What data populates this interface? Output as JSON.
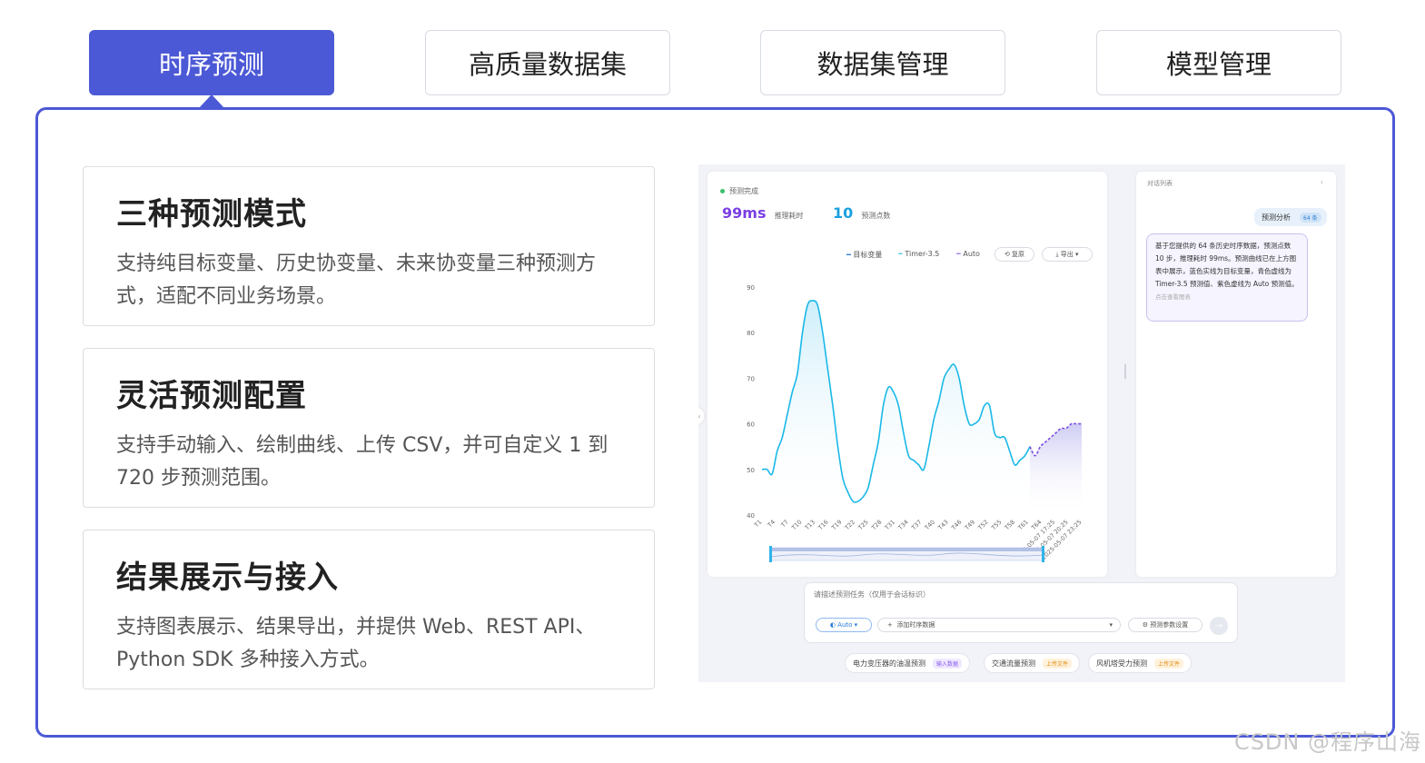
{
  "tabs": [
    {
      "label": "时序预测",
      "active": true
    },
    {
      "label": "高质量数据集",
      "active": false
    },
    {
      "label": "数据集管理",
      "active": false
    },
    {
      "label": "模型管理",
      "active": false
    }
  ],
  "features": [
    {
      "title": "三种预测模式",
      "desc": "支持纯目标变量、历史协变量、未来协变量三种预测方式，适配不同业务场景。"
    },
    {
      "title": "灵活预测配置",
      "desc": "支持手动输入、绘制曲线、上传 CSV，并可自定义 1 到 720 步预测范围。"
    },
    {
      "title": "结果展示与接入",
      "desc": "支持图表展示、结果导出，并提供 Web、REST API、Python SDK 多种接入方式。"
    }
  ],
  "app": {
    "status": "预测完成",
    "latency_value": "99ms",
    "latency_label": "推理耗时",
    "points_value": "10",
    "points_label": "预测点数",
    "legend": {
      "target": "目标变量",
      "timer": "Timer-3.5",
      "auto": "Auto",
      "reset": "复原",
      "export": "导出"
    },
    "chat": {
      "header": "对话列表",
      "badge": "预测分析",
      "badge_count": "64 条",
      "bubble": "基于您提供的 64 条历史时序数据，预测点数 10 步，推理耗时 99ms。预测曲线已在上方图表中展示，蓝色实线为目标变量，青色虚线为 Timer-3.5 预测值、紫色虚线为 Auto 预测值。",
      "hint": "点击查看图表"
    },
    "input": {
      "placeholder": "请描述预测任务（仅用于会话标识）",
      "model": "Auto",
      "add_data": "添加时序数据",
      "params": "预测参数设置"
    },
    "chips": [
      {
        "label": "电力变压器的油温预测",
        "tag": "输入数据",
        "color": "#8a5cf0",
        "bg": "#efe8ff"
      },
      {
        "label": "交通流量预测",
        "tag": "上传文件",
        "color": "#e08a10",
        "bg": "#fff2dc"
      },
      {
        "label": "风机塔受力预测",
        "tag": "上传文件",
        "color": "#e08a10",
        "bg": "#fff2dc"
      }
    ]
  },
  "chart_data": {
    "type": "line",
    "title": "",
    "xlabel": "",
    "ylabel": "",
    "ylim": [
      40,
      90
    ],
    "yticks": [
      40,
      50,
      60,
      70,
      80,
      90
    ],
    "x_tick_labels": [
      "T1",
      "T4",
      "T7",
      "T10",
      "T13",
      "T16",
      "T19",
      "T22",
      "T25",
      "T28",
      "T31",
      "T34",
      "T37",
      "T40",
      "T43",
      "T46",
      "T49",
      "T52",
      "T55",
      "T58",
      "T61",
      "T64",
      "2025-05-07 17:25",
      "2025-05-07 20:25",
      "2025-05-07 23:25"
    ],
    "series": [
      {
        "name": "目标变量",
        "color": "#1ab8e8",
        "style": "solid",
        "values": [
          50,
          50,
          49,
          54,
          57,
          62,
          67,
          71,
          80,
          86,
          87,
          86,
          80,
          72,
          64,
          55,
          48,
          45,
          43,
          43,
          44,
          46,
          51,
          56,
          64,
          68,
          67,
          64,
          58,
          53,
          52,
          51,
          50,
          55,
          61,
          65,
          70,
          72,
          73,
          70,
          64,
          60,
          60,
          61,
          64,
          64,
          58,
          57,
          57,
          54,
          51,
          52,
          53,
          55
        ]
      },
      {
        "name": "Auto",
        "color": "#7b4fe0",
        "style": "dashed",
        "values": [
          53,
          55,
          56,
          57,
          58,
          59,
          59,
          60,
          60,
          60
        ]
      }
    ],
    "grid": false,
    "legend": "top-right"
  },
  "watermark": "CSDN @程序山海"
}
